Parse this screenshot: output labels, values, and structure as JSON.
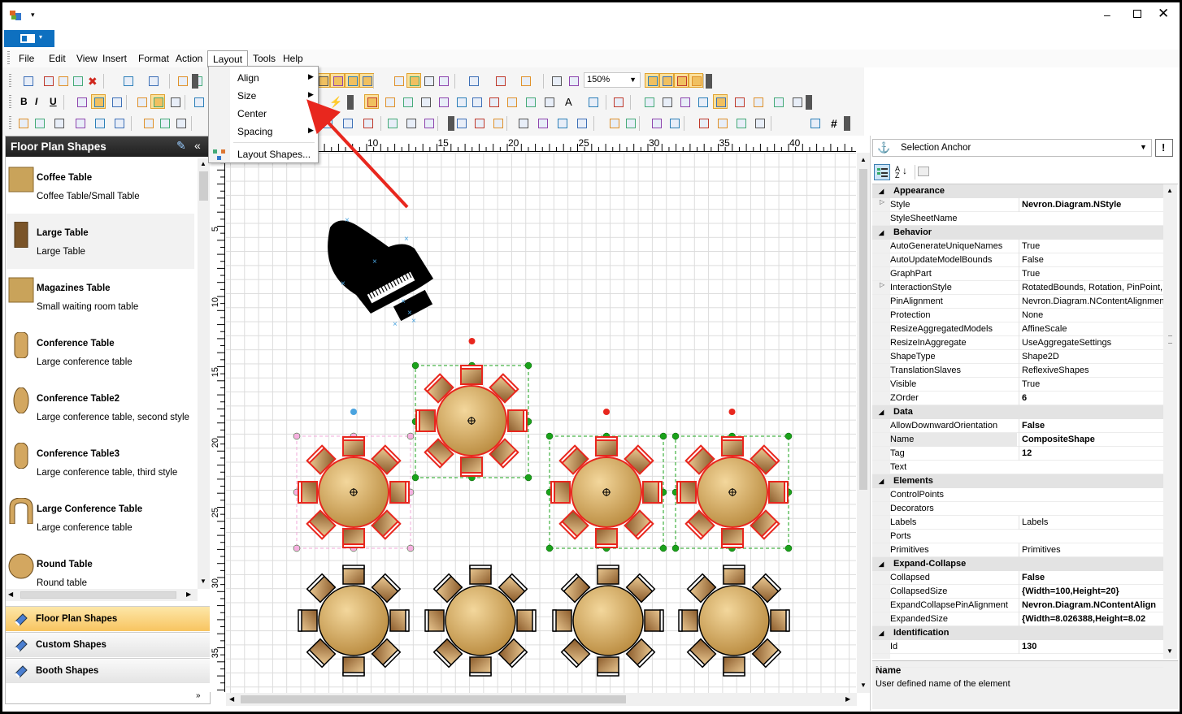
{
  "menu": {
    "items": [
      "File",
      "Edit",
      "View",
      "Insert",
      "Format",
      "Action",
      "Layout",
      "Tools",
      "Help"
    ]
  },
  "layout_menu": {
    "items": [
      {
        "label": "Align",
        "arrow": true
      },
      {
        "label": "Size",
        "arrow": true
      },
      {
        "label": "Center",
        "arrow": false
      },
      {
        "label": "Spacing",
        "arrow": true
      },
      {
        "label": "Layout Shapes...",
        "arrow": false
      }
    ]
  },
  "toolbar": {
    "zoom": "150%"
  },
  "shapes_panel": {
    "title": "Floor Plan Shapes",
    "items": [
      {
        "title": "Coffee Table",
        "desc": "Coffee Table/Small Table"
      },
      {
        "title": "Large Table",
        "desc": "Large Table"
      },
      {
        "title": "Magazines Table",
        "desc": "Small waiting room table"
      },
      {
        "title": "Conference Table",
        "desc": "Large conference table"
      },
      {
        "title": "Conference Table2",
        "desc": "Large conference table, second style"
      },
      {
        "title": "Conference Table3",
        "desc": "Large conference table, third style"
      },
      {
        "title": "Large Conference Table",
        "desc": "Large conference table"
      },
      {
        "title": "Round Table",
        "desc": "Round table"
      }
    ],
    "stacks": [
      "Floor Plan Shapes",
      "Custom Shapes",
      "Booth Shapes"
    ]
  },
  "ruler": {
    "h": [
      "10",
      "15",
      "20",
      "25",
      "30",
      "35",
      "40"
    ],
    "v": [
      "5",
      "10",
      "15",
      "20",
      "25",
      "30",
      "35"
    ]
  },
  "property_grid": {
    "selector": "Selection Anchor",
    "rows": [
      {
        "cat": "Appearance"
      },
      {
        "name": "Style",
        "value": "Nevron.Diagram.NStyle",
        "bold": true,
        "exp": true
      },
      {
        "name": "StyleSheetName",
        "value": ""
      },
      {
        "cat": "Behavior"
      },
      {
        "name": "AutoGenerateUniqueNames",
        "value": "True"
      },
      {
        "name": "AutoUpdateModelBounds",
        "value": "False"
      },
      {
        "name": "GraphPart",
        "value": "True"
      },
      {
        "name": "InteractionStyle",
        "value": "RotatedBounds, Rotation, PinPoint, S",
        "exp": true
      },
      {
        "name": "PinAlignment",
        "value": "Nevron.Diagram.NContentAlignment"
      },
      {
        "name": "Protection",
        "value": "None"
      },
      {
        "name": "ResizeAggregatedModels",
        "value": "AffineScale"
      },
      {
        "name": "ResizeInAggregate",
        "value": "UseAggregateSettings"
      },
      {
        "name": "ShapeType",
        "value": "Shape2D"
      },
      {
        "name": "TranslationSlaves",
        "value": "ReflexiveShapes"
      },
      {
        "name": "Visible",
        "value": "True"
      },
      {
        "name": "ZOrder",
        "value": "6",
        "bold": true
      },
      {
        "cat": "Data"
      },
      {
        "name": "AllowDownwardOrientation",
        "value": "False",
        "bold": true
      },
      {
        "name": "Name",
        "value": "CompositeShape",
        "bold": true,
        "selected": true
      },
      {
        "name": "Tag",
        "value": "12",
        "bold": true
      },
      {
        "name": "Text",
        "value": ""
      },
      {
        "cat": "Elements"
      },
      {
        "name": "ControlPoints",
        "value": ""
      },
      {
        "name": "Decorators",
        "value": ""
      },
      {
        "name": "Labels",
        "value": "Labels"
      },
      {
        "name": "Ports",
        "value": ""
      },
      {
        "name": "Primitives",
        "value": "Primitives"
      },
      {
        "cat": "Expand-Collapse"
      },
      {
        "name": "Collapsed",
        "value": "False",
        "bold": true
      },
      {
        "name": "CollapsedSize",
        "value": "{Width=100,Height=20}",
        "bold": true
      },
      {
        "name": "ExpandCollapsePinAlignment",
        "value": "Nevron.Diagram.NContentAlign",
        "bold": true
      },
      {
        "name": "ExpandedSize",
        "value": "{Width=8.026388,Height=8.02",
        "bold": true
      },
      {
        "cat": "Identification"
      },
      {
        "name": "Id",
        "value": "130",
        "bold": true
      },
      {
        "name": "",
        "value": ""
      }
    ],
    "help_title": "Name",
    "help_desc": "User defined name of the element"
  },
  "colors": {
    "accent": "#0e70c0",
    "selection": "#e8271e",
    "handle": "#1aa21a",
    "table": "#d3a760",
    "menu_highlight": "#fbe09a"
  }
}
